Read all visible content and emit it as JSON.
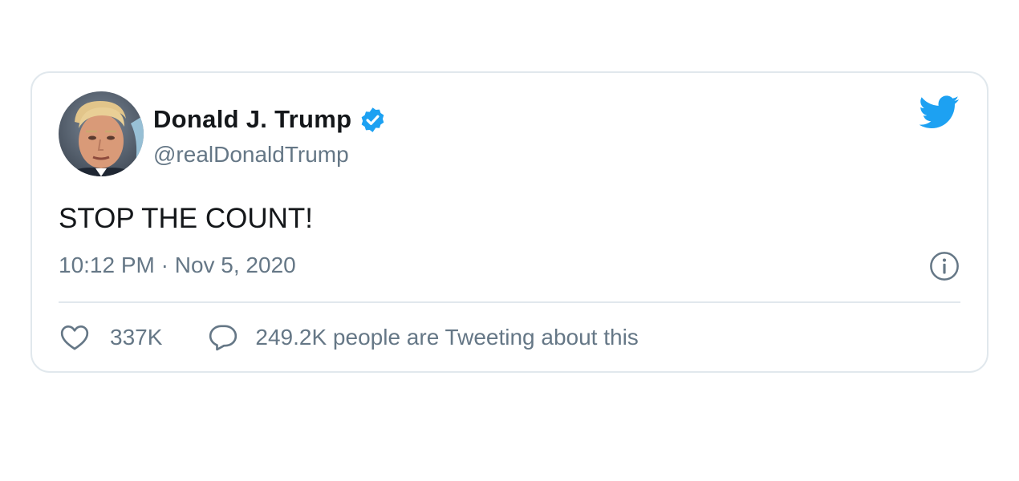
{
  "tweet": {
    "display_name": "Donald J. Trump",
    "handle": "@realDonaldTrump",
    "text": "STOP THE COUNT!",
    "timestamp": "10:12 PM · Nov 5, 2020",
    "like_count": "337K",
    "tweeting_about": "249.2K people are Tweeting about this"
  },
  "icons": {
    "verified": "verified-badge-icon",
    "brand": "twitter-bird-icon",
    "info": "info-icon",
    "like": "heart-icon",
    "reply": "speech-bubble-icon"
  },
  "colors": {
    "brand_blue": "#1da1f2",
    "text_primary": "#14171a",
    "text_secondary": "#657786",
    "border": "#e1e8ed"
  }
}
